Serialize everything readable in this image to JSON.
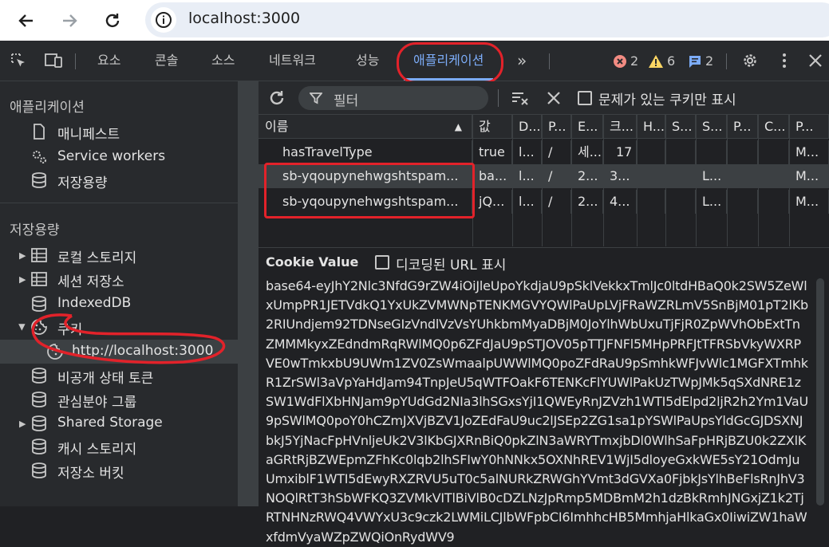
{
  "browser": {
    "url": "localhost:3000",
    "icons": [
      "back-arrow-icon",
      "forward-arrow-icon",
      "reload-icon",
      "site-info-icon"
    ]
  },
  "devtools": {
    "tabs": [
      "요소",
      "콘솔",
      "소스",
      "네트워크",
      "성능",
      "애플리케이션"
    ],
    "more_tabs": "»",
    "errors": "2",
    "warnings": "6",
    "messages": "2",
    "colors": {
      "accent": "#7cacf8",
      "error": "#f28b82",
      "warning": "#fdd663",
      "annotation": "#e2222a"
    }
  },
  "sidebar": {
    "section_app": "애플리케이션",
    "app_items": [
      "매니페스트",
      "Service workers",
      "저장용량"
    ],
    "section_storage": "저장용량",
    "storage_items": [
      "로컬 스토리지",
      "세션 저장소",
      "IndexedDB",
      "쿠키",
      "http://localhost:3000",
      "비공개 상태 토큰",
      "관심분야 그룹",
      "Shared Storage",
      "캐시 스토리지",
      "저장소 버킷"
    ]
  },
  "toolbar": {
    "filter_placeholder": "필터",
    "only_issues_label": "문제가 있는 쿠키만 표시"
  },
  "cookies_table": {
    "columns": [
      "이름",
      "값",
      "D...",
      "P...",
      "E...",
      "크...",
      "H...",
      "S...",
      "S...",
      "P...",
      "C...",
      "P..."
    ],
    "rows": [
      [
        "hasTravelType",
        "true",
        "l...",
        "/",
        "세...",
        "17",
        "",
        "",
        "",
        "",
        "",
        "M..."
      ],
      [
        "sb-yqoupynehwgshtspam...",
        "ba...",
        "l...",
        "/",
        "2...",
        "3...",
        "",
        "",
        "L...",
        "",
        "",
        "M..."
      ],
      [
        "sb-yqoupynehwgshtspam...",
        "jQ...",
        "l...",
        "/",
        "2...",
        "4...",
        "",
        "",
        "L...",
        "",
        "",
        "M..."
      ]
    ]
  },
  "cookie_value": {
    "header": "Cookie Value",
    "decode_label": "디코딩된 URL 표시",
    "value": "base64-eyJhY2Nlc3NfdG9rZW4iOiJleUpoYkdjaU9pSklVekkxTmlJc0ltdHBaQ0k2SW5ZeWlxUmpPR1JETVdkQ1YxUkZVMWNpTENKMGVYQWlPaUpLVjFRaWZRLmV5SnBjM01pT2lKb2RIUndjem92TDNseGIzVndlVzVsYUhkbmMyaDBjM0JoYlhWbUxuTjFjR0ZpWVhObExtTnZMMMkyxZEdndmRqRWlMQ0p6ZFdJaU9pSTJOV05pTTJFNFl5MHpPRFJtTFRSbVkyWXRPVE0wTmkxbU9UWm1ZV0ZsWmaalpUWWlMQ0poZFdRaU9pSmhkWFJvWlc1MGFXTmhkR1ZrSWl3aVpYaHdJam94TnpJeU5qWTFOakF6TENKcFlYUWlPakUzTWpJMk5qSXdNRE1zSW1WdFlXbHNJam9pYUdGd2NIa3lhSGxsYjI1QWEyRnJZVzh1WTI5dElpd2ljR2h2Ym1VaU9pSWlMQ0poY0hCZmJXVjBZV1JoZEdFaU9uc2lJSEp2ZG1sa1pYSWlPaUpsYldGcGJDSXNJbkJ5YjNacFpHVnljeUk2V3lKbGJXRnBiQ0pkZlN3aWRYTmxjbDl0WlhSaFpHRjBZU0k2ZXlKaGRtRjBZWEpmZFhKc0lqb2lhSFIwY0hNNkx5OXNhREV1WjI5dloyeGxkWE5sY21OdmJuUmxiblF1WTI5dEwyRXZRVU5uT0c5alNURkZRWGhYVmt3dGVXa0FjbkJsYlhBeFlsRnJhV3NOQlRtT3hSbWFKQ3ZVMkVITlBiVlB0cDZLNzJpRmp5MDBmM2h1dzBkRmhJNGxjZ1k2TjRTNHNzRWQ4VWYxU3c9czk2LWMiLCJlbWFpbCI6ImhhcHB5MmhjaHlkaGx0IiwiZW1haWxfdmVyaWZpZWQiOnRydWV9"
  }
}
